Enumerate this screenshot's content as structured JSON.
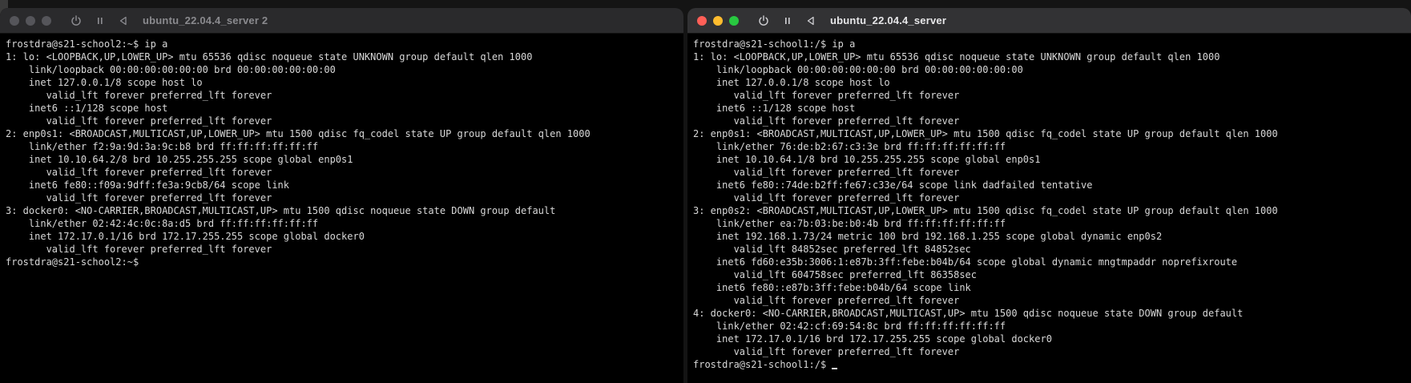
{
  "windows": [
    {
      "title": "ubuntu_22.04.4_server 2",
      "active": false,
      "lines": [
        "frostdra@s21-school2:~$ ip a",
        "1: lo: <LOOPBACK,UP,LOWER_UP> mtu 65536 qdisc noqueue state UNKNOWN group default qlen 1000",
        "    link/loopback 00:00:00:00:00:00 brd 00:00:00:00:00:00",
        "    inet 127.0.0.1/8 scope host lo",
        "       valid_lft forever preferred_lft forever",
        "    inet6 ::1/128 scope host",
        "       valid_lft forever preferred_lft forever",
        "2: enp0s1: <BROADCAST,MULTICAST,UP,LOWER_UP> mtu 1500 qdisc fq_codel state UP group default qlen 1000",
        "    link/ether f2:9a:9d:3a:9c:b8 brd ff:ff:ff:ff:ff:ff",
        "    inet 10.10.64.2/8 brd 10.255.255.255 scope global enp0s1",
        "       valid_lft forever preferred_lft forever",
        "    inet6 fe80::f09a:9dff:fe3a:9cb8/64 scope link",
        "       valid_lft forever preferred_lft forever",
        "3: docker0: <NO-CARRIER,BROADCAST,MULTICAST,UP> mtu 1500 qdisc noqueue state DOWN group default",
        "    link/ether 02:42:4c:0c:8a:d5 brd ff:ff:ff:ff:ff:ff",
        "    inet 172.17.0.1/16 brd 172.17.255.255 scope global docker0",
        "       valid_lft forever preferred_lft forever",
        "frostdra@s21-school2:~$"
      ]
    },
    {
      "title": "ubuntu_22.04.4_server",
      "active": true,
      "lines": [
        "frostdra@s21-school1:/$ ip a",
        "1: lo: <LOOPBACK,UP,LOWER_UP> mtu 65536 qdisc noqueue state UNKNOWN group default qlen 1000",
        "    link/loopback 00:00:00:00:00:00 brd 00:00:00:00:00:00",
        "    inet 127.0.0.1/8 scope host lo",
        "       valid_lft forever preferred_lft forever",
        "    inet6 ::1/128 scope host",
        "       valid_lft forever preferred_lft forever",
        "2: enp0s1: <BROADCAST,MULTICAST,UP,LOWER_UP> mtu 1500 qdisc fq_codel state UP group default qlen 1000",
        "    link/ether 76:de:b2:67:c3:3e brd ff:ff:ff:ff:ff:ff",
        "    inet 10.10.64.1/8 brd 10.255.255.255 scope global enp0s1",
        "       valid_lft forever preferred_lft forever",
        "    inet6 fe80::74de:b2ff:fe67:c33e/64 scope link dadfailed tentative",
        "       valid_lft forever preferred_lft forever",
        "3: enp0s2: <BROADCAST,MULTICAST,UP,LOWER_UP> mtu 1500 qdisc fq_codel state UP group default qlen 1000",
        "    link/ether ea:7b:03:be:b0:4b brd ff:ff:ff:ff:ff:ff",
        "    inet 192.168.1.73/24 metric 100 brd 192.168.1.255 scope global dynamic enp0s2",
        "       valid_lft 84852sec preferred_lft 84852sec",
        "    inet6 fd60:e35b:3006:1:e87b:3ff:febe:b04b/64 scope global dynamic mngtmpaddr noprefixroute",
        "       valid_lft 604758sec preferred_lft 86358sec",
        "    inet6 fe80::e87b:3ff:febe:b04b/64 scope link",
        "       valid_lft forever preferred_lft forever",
        "4: docker0: <NO-CARRIER,BROADCAST,MULTICAST,UP> mtu 1500 qdisc noqueue state DOWN group default",
        "    link/ether 02:42:cf:69:54:8c brd ff:ff:ff:ff:ff:ff",
        "    inet 172.17.0.1/16 brd 172.17.255.255 scope global docker0",
        "       valid_lft forever preferred_lft forever",
        "frostdra@s21-school1:/$ "
      ]
    }
  ]
}
